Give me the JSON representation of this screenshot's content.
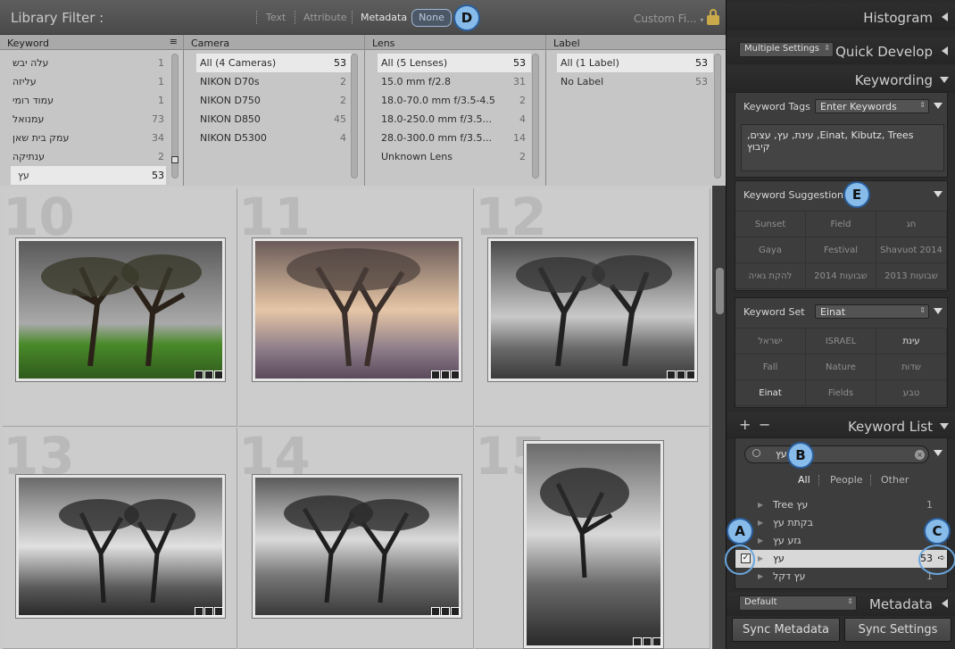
{
  "filter_bar": {
    "title": "Library Filter :",
    "tabs": [
      "Text",
      "Attribute",
      "Metadata",
      "None"
    ],
    "custom_filter": "Custom Fi...",
    "lock_icon": "lock-icon"
  },
  "columns": [
    {
      "header": "Keyword",
      "rows": [
        {
          "label": "עלה יבש",
          "count": "1"
        },
        {
          "label": "עליזה",
          "count": "1"
        },
        {
          "label": "עמוד רומי",
          "count": "1"
        },
        {
          "label": "עמנואל",
          "count": "73"
        },
        {
          "label": "עמק בית שאן",
          "count": "34"
        },
        {
          "label": "ענתיקה",
          "count": "2"
        },
        {
          "label": "עץ",
          "count": "53",
          "selected": true
        }
      ]
    },
    {
      "header": "Camera",
      "rows": [
        {
          "label": "All (4 Cameras)",
          "count": "53",
          "selected": true
        },
        {
          "label": "NIKON D70s",
          "count": "2"
        },
        {
          "label": "NIKON D750",
          "count": "2"
        },
        {
          "label": "NIKON D850",
          "count": "45"
        },
        {
          "label": "NIKON D5300",
          "count": "4"
        }
      ]
    },
    {
      "header": "Lens",
      "rows": [
        {
          "label": "All (5 Lenses)",
          "count": "53",
          "selected": true
        },
        {
          "label": "15.0 mm f/2.8",
          "count": "31"
        },
        {
          "label": "18.0-70.0 mm f/3.5-4.5",
          "count": "2"
        },
        {
          "label": "18.0-250.0 mm f/3.5...",
          "count": "4"
        },
        {
          "label": "28.0-300.0 mm f/3.5...",
          "count": "14"
        },
        {
          "label": "Unknown Lens",
          "count": "2"
        }
      ]
    },
    {
      "header": "Label",
      "rows": [
        {
          "label": "All (1 Label)",
          "count": "53",
          "selected": true
        },
        {
          "label": "No Label",
          "count": "53"
        }
      ]
    }
  ],
  "grid": {
    "cells": [
      {
        "index": "10"
      },
      {
        "index": "11"
      },
      {
        "index": "12"
      },
      {
        "index": "13"
      },
      {
        "index": "14"
      },
      {
        "index": "15"
      }
    ]
  },
  "right_panel": {
    "histogram": "Histogram",
    "quick_develop": "Quick Develop",
    "multiple_settings": "Multiple Settings",
    "keywording": "Keywording",
    "keyword_tags_label": "Keyword Tags",
    "keyword_tags_mode": "Enter Keywords",
    "keyword_tags_value": "Einat, Kibutz, Trees, עינת, עץ, עצים, קיבוץ",
    "keyword_suggestions_label": "Keyword Suggestions",
    "suggestions": [
      "Sunset",
      "Field",
      "חג",
      "Gaya",
      "Festival",
      "Shavuot 2014",
      "להקת גאיה",
      "שבועות 2014",
      "שבועות 2013"
    ],
    "keyword_set_label": "Keyword Set",
    "keyword_set_value": "Einat",
    "keyword_set": [
      "ישראל",
      "ISRAEL",
      "עינת",
      "Fall",
      "Nature",
      "שדות",
      "Einat",
      "Fields",
      "טבע"
    ],
    "keyword_list": "Keyword List",
    "plus": "+",
    "minus": "−",
    "search_value": "עץ",
    "filter_tabs": [
      "All",
      "People",
      "Other"
    ],
    "keywords": [
      {
        "label": "Tree  עץ",
        "count": "1"
      },
      {
        "label": "בקתת עץ",
        "count": ""
      },
      {
        "label": "גזע עץ",
        "count": ""
      },
      {
        "label": "עץ",
        "count": "53",
        "selected": true
      },
      {
        "label": "עץ דקל",
        "count": "1"
      }
    ],
    "metadata": "Metadata",
    "default_preset": "Default",
    "sync_metadata": "Sync Metadata",
    "sync_settings": "Sync Settings"
  },
  "callouts": {
    "a": "A",
    "b": "B",
    "c": "C",
    "d": "D",
    "e": "E"
  }
}
